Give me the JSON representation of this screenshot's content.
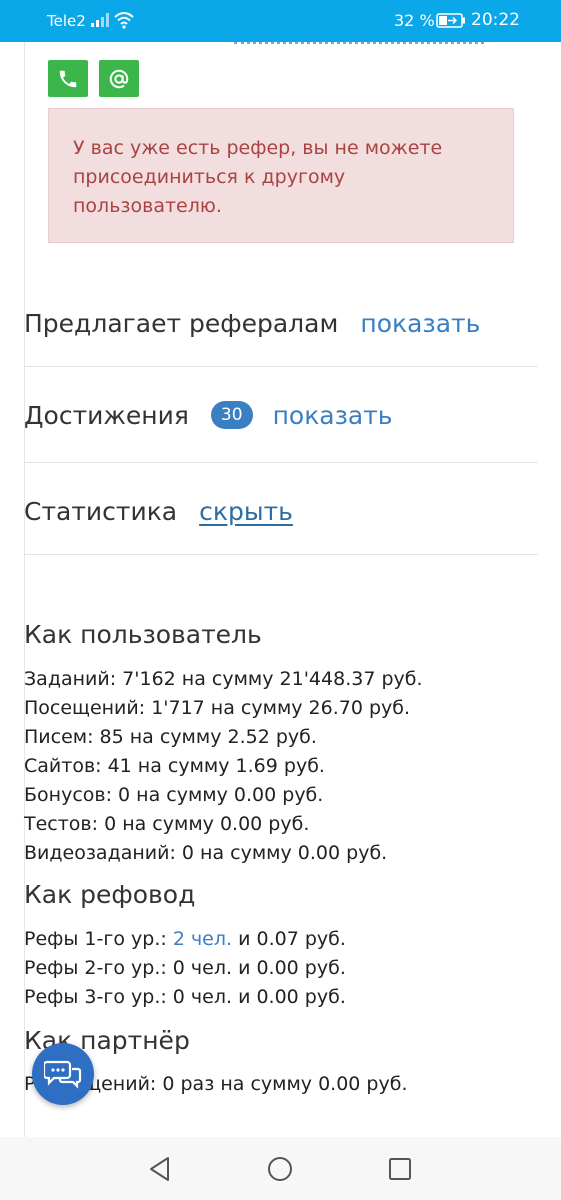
{
  "status_bar": {
    "carrier": "Tele2",
    "battery_percent": "32 %",
    "time": "20:22"
  },
  "alert": {
    "message": "У вас уже есть рефер, вы не можете присоединиться к другому пользователю."
  },
  "sections": {
    "offers": {
      "label": "Предлагает рефералам",
      "action": "показать"
    },
    "achievements": {
      "label": "Достижения",
      "badge": "30",
      "action": "показать"
    },
    "statistics": {
      "label": "Статистика",
      "action": "скрыть"
    }
  },
  "as_user": {
    "heading": "Как пользователь",
    "lines": [
      "Заданий: 7'162 на сумму 21'448.37 руб.",
      "Посещений: 1'717 на сумму 26.70 руб.",
      "Писем: 85 на сумму 2.52 руб.",
      "Сайтов: 41 на сумму 1.69 руб.",
      "Бонусов: 0 на сумму 0.00 руб.",
      "Тестов: 0 на сумму 0.00 руб.",
      "Видеозаданий: 0 на сумму 0.00 руб."
    ]
  },
  "as_referrer": {
    "heading": "Как рефовод",
    "level1_prefix": "Рефы 1-го ур.:",
    "level1_link": "2 чел.",
    "level1_suffix": "и 0.07 руб.",
    "level2": "Рефы 2-го ур.: 0 чел. и 0.00 руб.",
    "level3": "Рефы 3-го ур.: 0 чел. и 0.00 руб."
  },
  "as_partner": {
    "heading": "Как партнёр",
    "line": "Размещений: 0 раз на сумму 0.00 руб."
  },
  "colors": {
    "status_bar": "#0aa8e8",
    "accent": "#3a7fc1",
    "contact_green": "#3cb54a",
    "alert_bg": "#f2dede",
    "alert_text": "#a94442",
    "fab": "#2f6fc3"
  }
}
